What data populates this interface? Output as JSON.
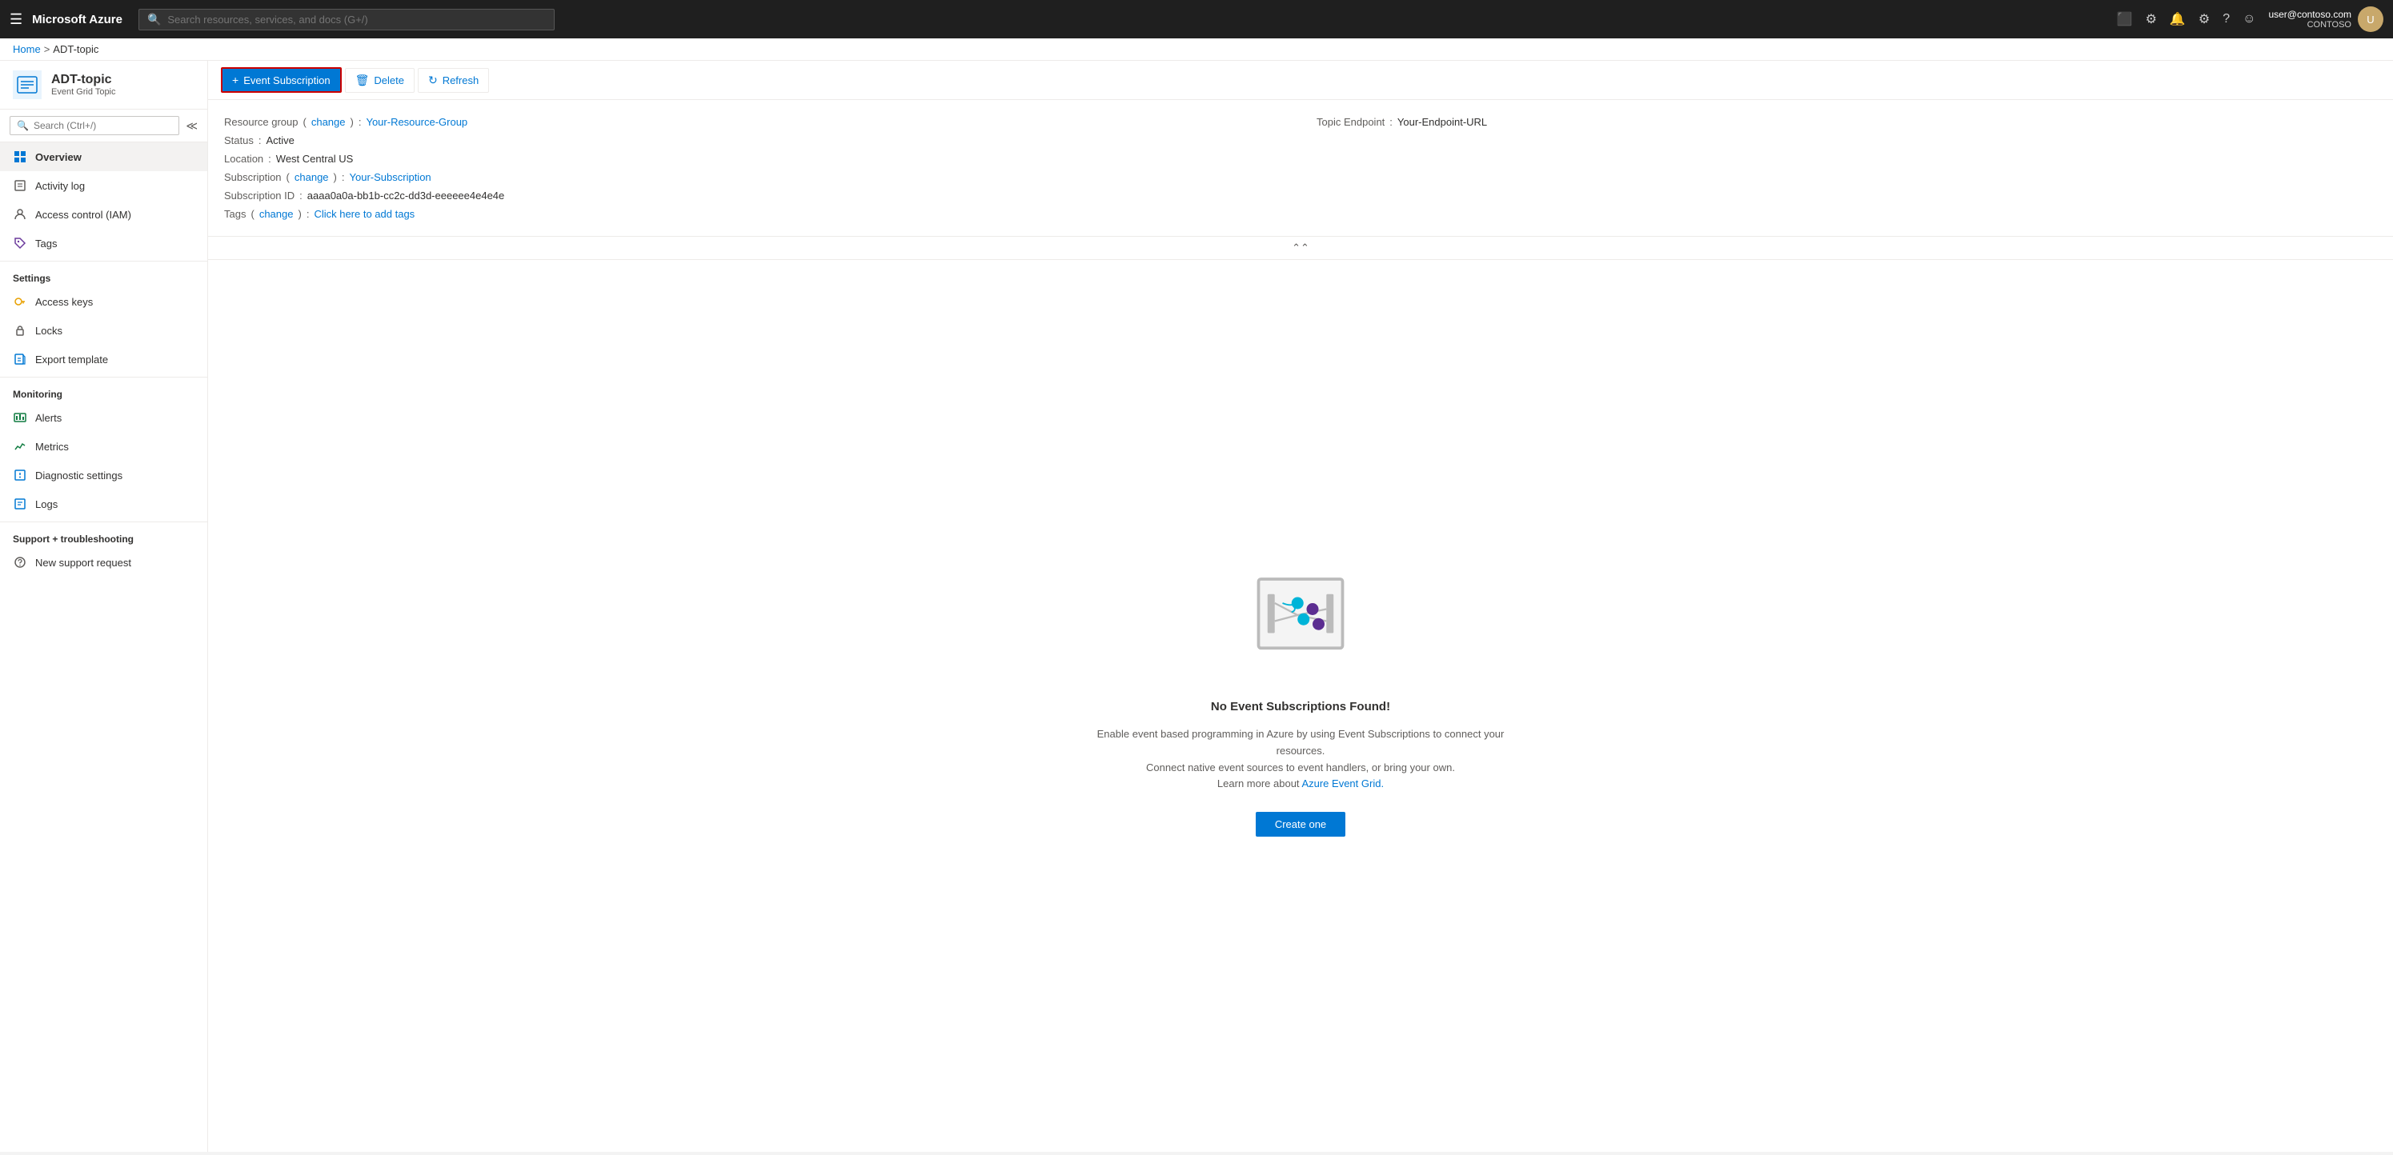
{
  "topnav": {
    "hamburger": "☰",
    "brand": "Microsoft Azure",
    "search_placeholder": "Search resources, services, and docs (G+/)",
    "user_email": "user@contoso.com",
    "user_tenant": "CONTOSO"
  },
  "breadcrumb": {
    "home": "Home",
    "separator": ">",
    "current": "ADT-topic"
  },
  "sidebar": {
    "resource_title": "ADT-topic",
    "resource_subtitle": "Event Grid Topic",
    "search_placeholder": "Search (Ctrl+/)",
    "nav_items": [
      {
        "id": "overview",
        "label": "Overview",
        "icon": "⊞",
        "active": true
      },
      {
        "id": "activity-log",
        "label": "Activity log",
        "icon": "📋"
      },
      {
        "id": "iam",
        "label": "Access control (IAM)",
        "icon": "👤"
      },
      {
        "id": "tags",
        "label": "Tags",
        "icon": "🏷"
      }
    ],
    "settings_section": "Settings",
    "settings_items": [
      {
        "id": "access-keys",
        "label": "Access keys",
        "icon": "🔑"
      },
      {
        "id": "locks",
        "label": "Locks",
        "icon": "🔒"
      },
      {
        "id": "export-template",
        "label": "Export template",
        "icon": "📤"
      }
    ],
    "monitoring_section": "Monitoring",
    "monitoring_items": [
      {
        "id": "alerts",
        "label": "Alerts",
        "icon": "🔔"
      },
      {
        "id": "metrics",
        "label": "Metrics",
        "icon": "📊"
      },
      {
        "id": "diagnostic",
        "label": "Diagnostic settings",
        "icon": "🛠"
      },
      {
        "id": "logs",
        "label": "Logs",
        "icon": "📝"
      }
    ],
    "support_section": "Support + troubleshooting",
    "support_items": [
      {
        "id": "support-request",
        "label": "New support request",
        "icon": "💬"
      }
    ]
  },
  "toolbar": {
    "event_subscription_label": "Event Subscription",
    "delete_label": "Delete",
    "refresh_label": "Refresh"
  },
  "properties": {
    "resource_group_label": "Resource group",
    "resource_group_change": "change",
    "resource_group_value": "Your-Resource-Group",
    "status_label": "Status",
    "status_value": "Active",
    "location_label": "Location",
    "location_value": "West Central US",
    "subscription_label": "Subscription",
    "subscription_change": "change",
    "subscription_value": "Your-Subscription",
    "subscription_id_label": "Subscription ID",
    "subscription_id_value": "aaaa0a0a-bb1b-cc2c-dd3d-eeeeee4e4e4e",
    "tags_label": "Tags",
    "tags_change": "change",
    "tags_value": "Click here to add tags",
    "topic_endpoint_label": "Topic Endpoint",
    "topic_endpoint_value": "Your-Endpoint-URL"
  },
  "empty_state": {
    "title": "No Event Subscriptions Found!",
    "desc_line1": "Enable event based programming in Azure by using Event Subscriptions to connect your resources.",
    "desc_line2": "Connect native event sources to event handlers, or bring your own.",
    "desc_line3_prefix": "Learn more about ",
    "desc_link": "Azure Event Grid.",
    "create_label": "Create one"
  }
}
